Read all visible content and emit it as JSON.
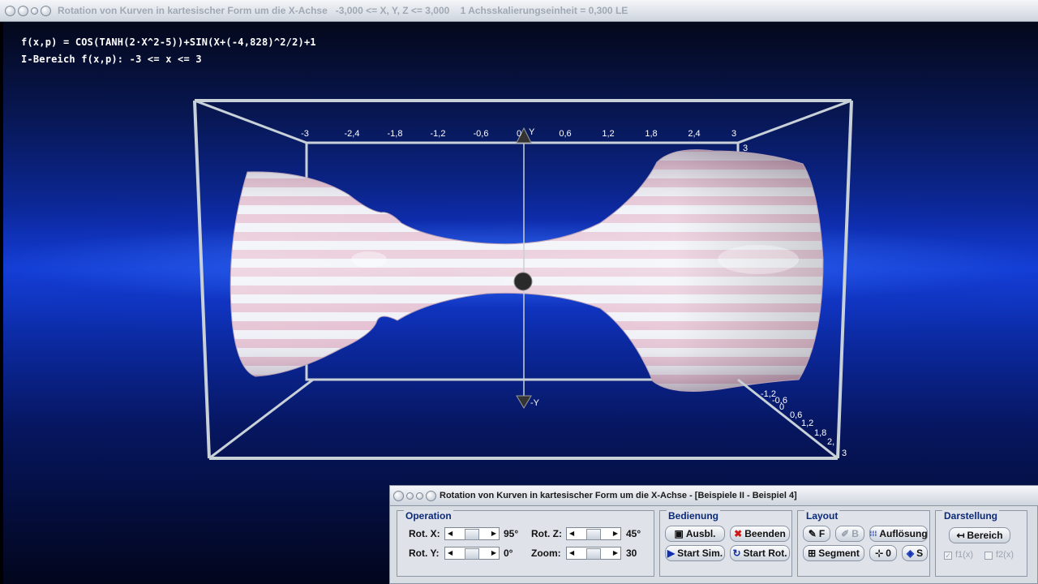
{
  "window": {
    "title": "Rotation von Kurven in kartesischer Form um die X-Achse   -3,000 <= X, Y, Z <= 3,000    1 Achsskalierungseinheit = 0,300 LE"
  },
  "formula": {
    "function": "f(x,p) = COS(TANH(2·X^2-5))+SIN(X+(-4,828)^2/2)+1",
    "range": "I-Bereich f(x,p): -3 <= x <= 3"
  },
  "axes": {
    "x_ticks": [
      "-3",
      "-2,4",
      "-1,8",
      "-1,2",
      "-0,6",
      "0",
      "0,6",
      "1,2",
      "1,8",
      "2,4",
      "3"
    ],
    "y_label": "Y",
    "neg_y_label": "-Y",
    "z_ticks": [
      "3",
      "-1,2",
      "-0,6",
      "0",
      "0,6",
      "1,2",
      "1,8",
      "2,",
      "3"
    ]
  },
  "panel": {
    "title": "Rotation von Kurven in kartesischer Form um die X-Achse - [Beispiele II - Beispiel 4]",
    "operation": {
      "label": "Operation",
      "rot_x_label": "Rot. X:",
      "rot_x_value": "95°",
      "rot_y_label": "Rot. Y:",
      "rot_y_value": "0°",
      "rot_z_label": "Rot. Z:",
      "rot_z_value": "45°",
      "zoom_label": "Zoom:",
      "zoom_value": "30"
    },
    "bedienung": {
      "label": "Bedienung",
      "ausbl": "Ausbl.",
      "beenden": "Beenden",
      "start_sim": "Start Sim.",
      "start_rot": "Start Rot."
    },
    "layout": {
      "label": "Layout",
      "f": "F",
      "b": "B",
      "aufloesung": "Auflösung",
      "segment": "Segment",
      "zero": "0",
      "s": "S"
    },
    "darstellung": {
      "label": "Darstellung",
      "bereich": "Bereich",
      "f1": "f1(x)",
      "f2": "f2(x)"
    }
  },
  "colors": {
    "stripe_pink": "#e0b8cc",
    "stripe_white": "#eef0f7",
    "label_blue": "#0b2a7a",
    "background_blue": "#1240d8"
  }
}
